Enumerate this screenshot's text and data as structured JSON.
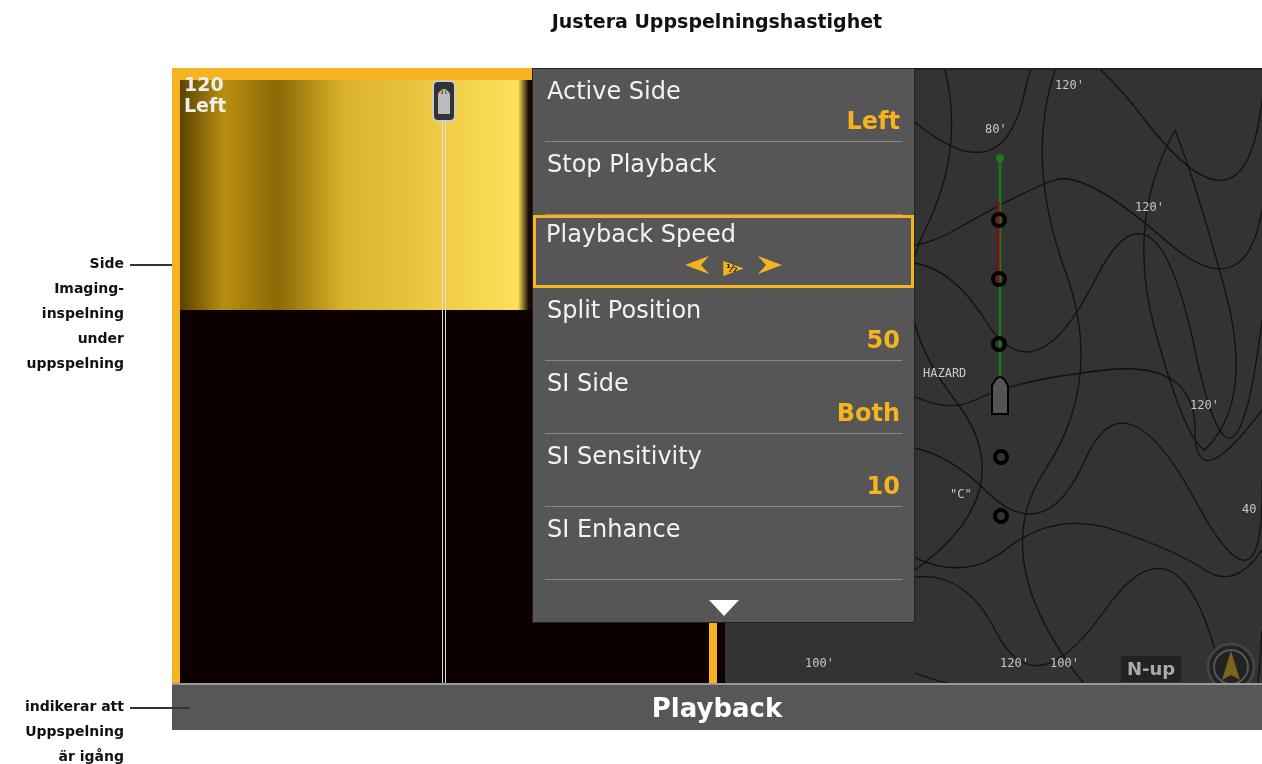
{
  "title": "Justera Uppspelningshastighet",
  "callouts": [
    {
      "text": "Side Imaging-inspelning under uppspelning"
    },
    {
      "text": "indikerar att Uppspelning är igång"
    }
  ],
  "sonar": {
    "range": "120",
    "side": "Left"
  },
  "menu": {
    "items": [
      {
        "kind": "value",
        "label": "Active Side",
        "value": "Left",
        "selected": false
      },
      {
        "kind": "action",
        "label": "Stop Playback",
        "selected": false
      },
      {
        "kind": "speed",
        "label": "Playback Speed",
        "value": "½",
        "selected": true
      },
      {
        "kind": "value",
        "label": "Split Position",
        "value": "50",
        "selected": false
      },
      {
        "kind": "value",
        "label": "SI Side",
        "value": "Both",
        "selected": false
      },
      {
        "kind": "value",
        "label": "SI Sensitivity",
        "value": "10",
        "selected": false
      },
      {
        "kind": "action",
        "label": "SI Enhance",
        "selected": false
      }
    ]
  },
  "map": {
    "labels": [
      "120'",
      "80'",
      "120'",
      "HAZARD",
      "120'",
      "\"C\"",
      "40",
      "100'",
      "120'",
      "100'"
    ],
    "orientation": "N-up"
  },
  "status_bar": {
    "label": "Playback"
  }
}
